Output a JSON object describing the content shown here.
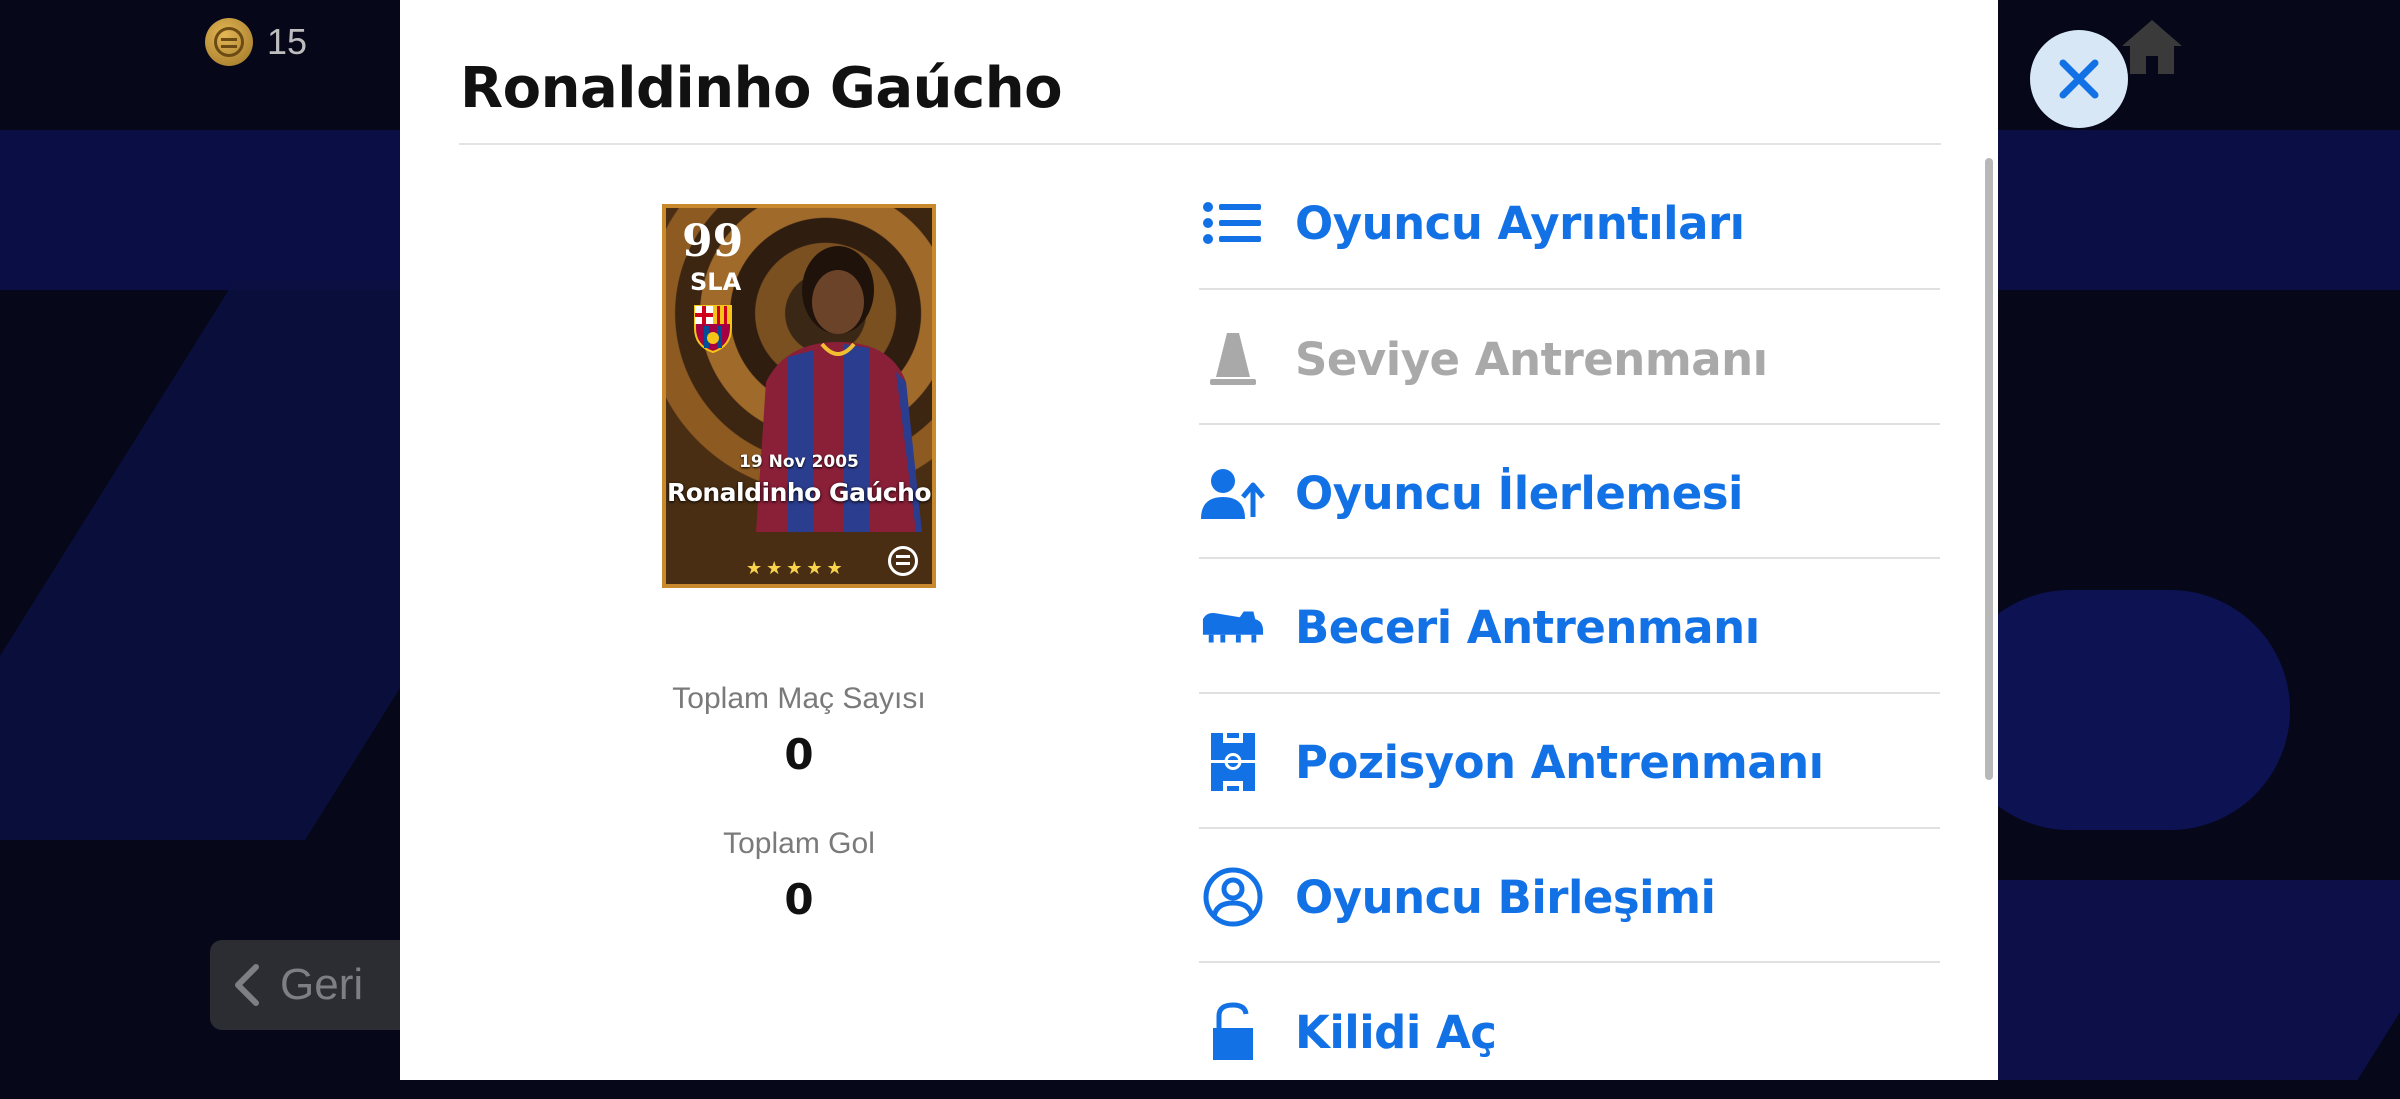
{
  "currency": {
    "count": "15"
  },
  "background": {
    "back_label": "Geri"
  },
  "modal": {
    "title": "Ronaldinho Gaúcho",
    "card": {
      "rating": "99",
      "position": "SLA",
      "date": "19 Nov 2005",
      "name": "Ronaldinho Gaúcho",
      "stars": "★★★★★"
    },
    "stats": [
      {
        "label": "Toplam Maç Sayısı",
        "value": "0"
      },
      {
        "label": "Toplam Gol",
        "value": "0"
      }
    ],
    "menu": [
      {
        "label": "Oyuncu Ayrıntıları",
        "icon": "list-icon",
        "enabled": true
      },
      {
        "label": "Seviye Antrenmanı",
        "icon": "training-cone-icon",
        "enabled": false
      },
      {
        "label": "Oyuncu İlerlemesi",
        "icon": "player-progress-icon",
        "enabled": true
      },
      {
        "label": "Beceri Antrenmanı",
        "icon": "football-boot-icon",
        "enabled": true
      },
      {
        "label": "Pozisyon Antrenmanı",
        "icon": "pitch-icon",
        "enabled": true
      },
      {
        "label": "Oyuncu Birleşimi",
        "icon": "player-merge-icon",
        "enabled": true
      },
      {
        "label": "Kilidi Aç",
        "icon": "unlock-icon",
        "enabled": true
      }
    ]
  },
  "colors": {
    "accent": "#1371e6",
    "disabled": "#a9a9a9",
    "close_bg": "#d7e7f5"
  }
}
